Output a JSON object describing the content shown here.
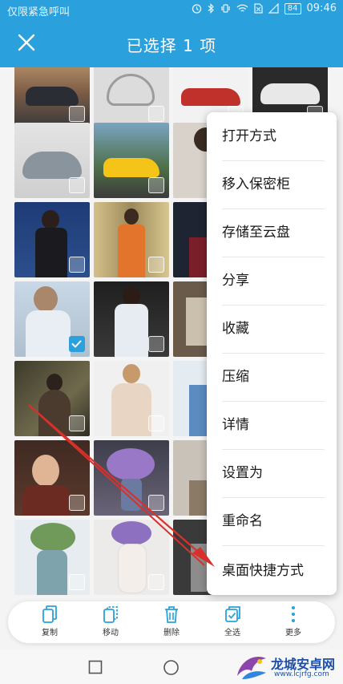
{
  "status_bar": {
    "carrier": "仅限紧急呼叫",
    "battery": "84",
    "time": "09:46"
  },
  "header": {
    "title": "已选择 1 项"
  },
  "context_menu": {
    "items": [
      "打开方式",
      "移入保密柜",
      "存储至云盘",
      "分享",
      "收藏",
      "压缩",
      "详情",
      "设置为",
      "重命名",
      "桌面快捷方式"
    ]
  },
  "toolbar": {
    "copy": "复制",
    "move": "移动",
    "delete": "删除",
    "select_all": "全选",
    "more": "更多"
  },
  "watermark": {
    "title": "龙城安卓网",
    "url": "www.lcjrfg.com"
  },
  "colors": {
    "accent": "#2aa0dc",
    "annotation_arrow": "#d9302c"
  }
}
